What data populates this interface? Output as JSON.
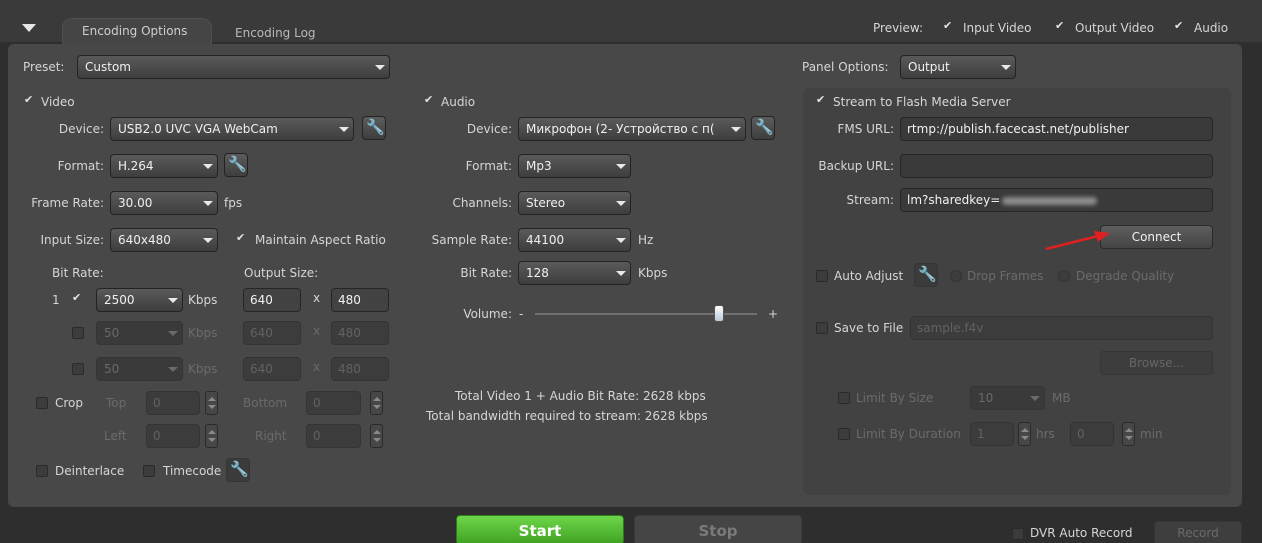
{
  "tabs": {
    "active": "Encoding Options",
    "inactive": "Encoding Log"
  },
  "preview": {
    "label": "Preview:",
    "input_video": "Input Video",
    "output_video": "Output Video",
    "audio": "Audio"
  },
  "preset": {
    "label": "Preset:",
    "value": "Custom"
  },
  "panel_options": {
    "label": "Panel Options:",
    "value": "Output"
  },
  "video": {
    "title": "Video",
    "device_label": "Device:",
    "device_value": "USB2.0 UVC VGA WebCam",
    "format_label": "Format:",
    "format_value": "H.264",
    "frame_rate_label": "Frame Rate:",
    "frame_rate_value": "30.00",
    "frame_rate_unit": "fps",
    "input_size_label": "Input Size:",
    "input_size_value": "640x480",
    "maintain_aspect": "Maintain Aspect Ratio",
    "bit_rate_label": "Bit Rate:",
    "output_size_label": "Output Size:",
    "rows": [
      {
        "index": "1",
        "bitrate": "2500",
        "unit": "Kbps",
        "width": "640",
        "x": "x",
        "height": "480"
      },
      {
        "index": "",
        "bitrate": "50",
        "unit": "Kbps",
        "width": "640",
        "x": "x",
        "height": "480"
      },
      {
        "index": "",
        "bitrate": "50",
        "unit": "Kbps",
        "width": "640",
        "x": "x",
        "height": "480"
      }
    ],
    "crop_label": "Crop",
    "top_label": "Top",
    "bottom_label": "Bottom",
    "left_label": "Left",
    "right_label": "Right",
    "crop_top": "0",
    "crop_bottom": "0",
    "crop_left": "0",
    "crop_right": "0",
    "deinterlace": "Deinterlace",
    "timecode": "Timecode"
  },
  "audio": {
    "title": "Audio",
    "device_label": "Device:",
    "device_value": "Микрофон (2- Устройство с п(",
    "format_label": "Format:",
    "format_value": "Mp3",
    "channels_label": "Channels:",
    "channels_value": "Stereo",
    "sample_rate_label": "Sample Rate:",
    "sample_rate_value": "44100",
    "sample_rate_unit": "Hz",
    "bit_rate_label": "Bit Rate:",
    "bit_rate_value": "128",
    "bit_rate_unit": "Kbps",
    "volume_label": "Volume:",
    "volume_minus": "-",
    "volume_plus": "+",
    "volume_level": 0.83,
    "total_line1": "Total Video 1 + Audio Bit Rate:  2628 kbps",
    "total_line2": "Total bandwidth required to stream:  2628 kbps"
  },
  "stream": {
    "title": "Stream to Flash Media Server",
    "fms_url_label": "FMS URL:",
    "fms_url_value": "rtmp://publish.facecast.net/publisher",
    "backup_url_label": "Backup URL:",
    "backup_url_value": "",
    "stream_label": "Stream:",
    "stream_value": "lm?sharedkey=",
    "connect": "Connect",
    "auto_adjust": "Auto Adjust",
    "drop_frames": "Drop Frames",
    "degrade_quality": "Degrade Quality",
    "save_to_file": "Save to File",
    "save_file_value": "sample.f4v",
    "browse": "Browse...",
    "limit_by_size": "Limit By Size",
    "limit_size_value": "10",
    "limit_size_unit": "MB",
    "limit_by_duration": "Limit By Duration",
    "duration_hrs_value": "1",
    "hrs": "hrs",
    "duration_min_value": "0",
    "min": "min"
  },
  "bottom": {
    "start": "Start",
    "stop": "Stop",
    "dvr_auto_record": "DVR Auto Record",
    "record": "Record"
  },
  "colors": {
    "start_green": "#4fb531",
    "annotation_red": "#e02020"
  }
}
